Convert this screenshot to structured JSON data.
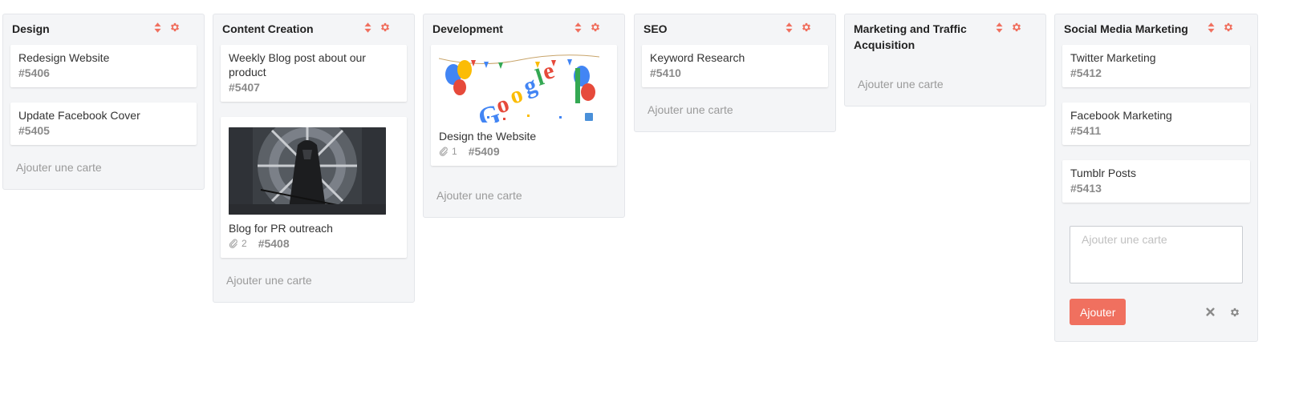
{
  "colors": {
    "accent": "#f0705f",
    "list_bg": "#f4f5f7",
    "muted": "#9a9a9a"
  },
  "icons": {
    "sort": "sort-updown-icon",
    "settings": "gear-icon",
    "attachment": "paperclip-icon",
    "close": "close-icon"
  },
  "lists": [
    {
      "title": "Design",
      "add_label": "Ajouter une carte",
      "cards": [
        {
          "title": "Redesign Website",
          "id": "#5406"
        },
        {
          "title": "Update Facebook Cover",
          "id": "#5405"
        }
      ]
    },
    {
      "title": "Content Creation",
      "add_label": "Ajouter une carte",
      "cards": [
        {
          "title": "Weekly Blog post about our product",
          "id": "#5407"
        },
        {
          "title": "Blog for PR outreach",
          "id": "#5408",
          "attachments": "2"
        }
      ]
    },
    {
      "title": "Development",
      "add_label": "Ajouter une carte",
      "cards": [
        {
          "title": "Design the Website",
          "id": "#5409",
          "attachments": "1"
        }
      ]
    },
    {
      "title": "SEO",
      "add_label": "Ajouter une carte",
      "cards": [
        {
          "title": "Keyword Research",
          "id": "#5410"
        }
      ]
    },
    {
      "title": "Marketing and Traffic Acquisition",
      "add_label": "Ajouter une carte",
      "cards": []
    },
    {
      "title": "Social Media Marketing",
      "cards": [
        {
          "title": "Twitter Marketing",
          "id": "#5412"
        },
        {
          "title": "Facebook Marketing",
          "id": "#5411"
        },
        {
          "title": "Tumblr Posts",
          "id": "#5413"
        }
      ],
      "composer": {
        "placeholder": "Ajouter une carte",
        "button_label": "Ajouter"
      }
    }
  ]
}
